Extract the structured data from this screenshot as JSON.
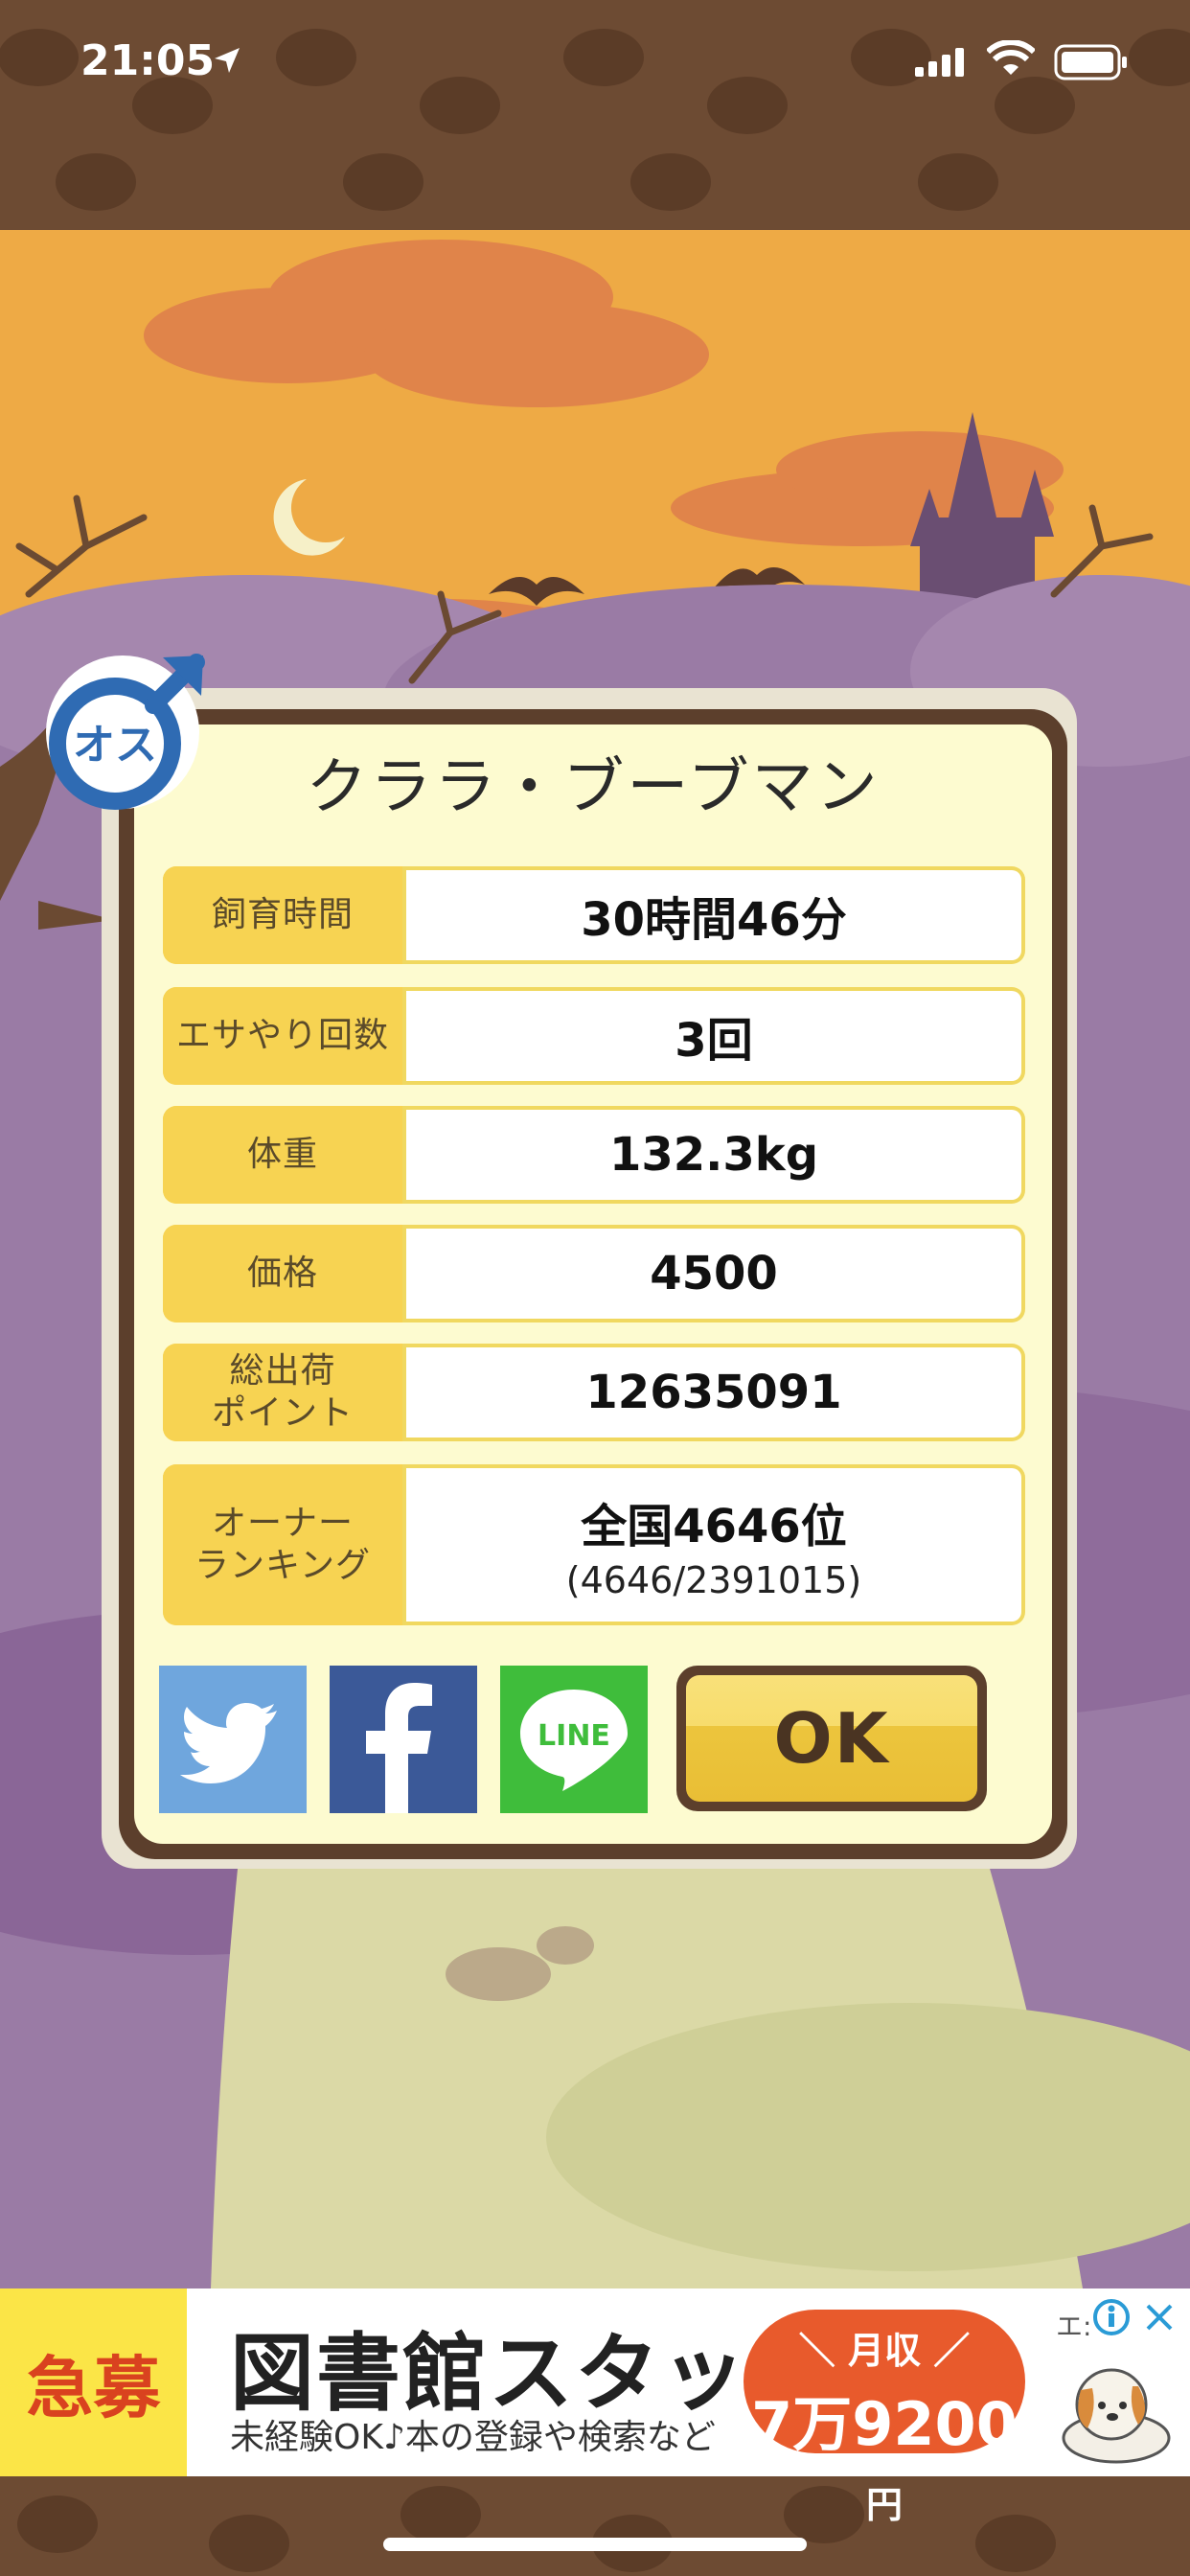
{
  "status_bar": {
    "time": "21:05"
  },
  "dialog": {
    "gender_badge": "オス",
    "name": "クララ・ブーブマン",
    "rows": [
      {
        "label": "飼育時間",
        "value": "30時間46分",
        "sub": ""
      },
      {
        "label": "エサやり回数",
        "value": "3回",
        "sub": ""
      },
      {
        "label": "体重",
        "value": "132.3kg",
        "sub": ""
      },
      {
        "label": "価格",
        "value": "4500",
        "sub": ""
      },
      {
        "label": "総出荷\nポイント",
        "value": "12635091",
        "sub": ""
      },
      {
        "label": "オーナー\nランキング",
        "value": "全国4646位",
        "sub": "(4646/2391015)"
      }
    ],
    "share_buttons": [
      "twitter-icon",
      "facebook-icon",
      "line-icon"
    ],
    "line_text": "LINE",
    "ok_label": "OK"
  },
  "ad": {
    "tag": "急募",
    "headline": "図書館スタッフ",
    "subline": "未経験OK♪本の登録や検索など",
    "salary_top": "＼ 月収 ／",
    "salary_main": "7万9200",
    "salary_unit": "円",
    "corner_text": "エ:"
  },
  "colors": {
    "frame_brown": "#5c3f2c",
    "panel_cream": "#fdfbd0",
    "label_yellow": "#f7d352",
    "twitter": "#6fa6dd",
    "facebook": "#3b5998",
    "line": "#3fbd3b",
    "sky_orange": "#eeaa45",
    "hill_purple": "#9a7ba5"
  }
}
